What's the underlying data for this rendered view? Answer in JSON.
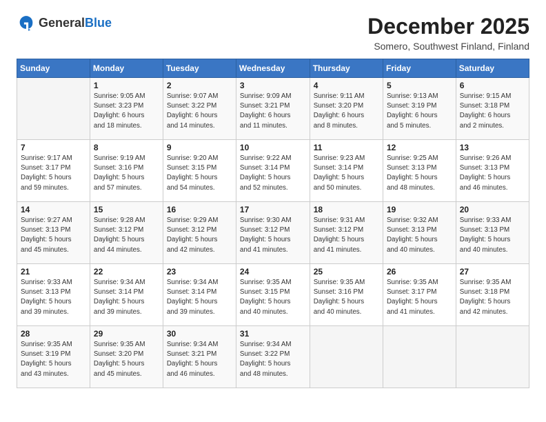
{
  "header": {
    "logo_general": "General",
    "logo_blue": "Blue",
    "month": "December 2025",
    "location": "Somero, Southwest Finland, Finland"
  },
  "weekdays": [
    "Sunday",
    "Monday",
    "Tuesday",
    "Wednesday",
    "Thursday",
    "Friday",
    "Saturday"
  ],
  "weeks": [
    [
      {
        "day": "",
        "info": ""
      },
      {
        "day": "1",
        "info": "Sunrise: 9:05 AM\nSunset: 3:23 PM\nDaylight: 6 hours\nand 18 minutes."
      },
      {
        "day": "2",
        "info": "Sunrise: 9:07 AM\nSunset: 3:22 PM\nDaylight: 6 hours\nand 14 minutes."
      },
      {
        "day": "3",
        "info": "Sunrise: 9:09 AM\nSunset: 3:21 PM\nDaylight: 6 hours\nand 11 minutes."
      },
      {
        "day": "4",
        "info": "Sunrise: 9:11 AM\nSunset: 3:20 PM\nDaylight: 6 hours\nand 8 minutes."
      },
      {
        "day": "5",
        "info": "Sunrise: 9:13 AM\nSunset: 3:19 PM\nDaylight: 6 hours\nand 5 minutes."
      },
      {
        "day": "6",
        "info": "Sunrise: 9:15 AM\nSunset: 3:18 PM\nDaylight: 6 hours\nand 2 minutes."
      }
    ],
    [
      {
        "day": "7",
        "info": "Sunrise: 9:17 AM\nSunset: 3:17 PM\nDaylight: 5 hours\nand 59 minutes."
      },
      {
        "day": "8",
        "info": "Sunrise: 9:19 AM\nSunset: 3:16 PM\nDaylight: 5 hours\nand 57 minutes."
      },
      {
        "day": "9",
        "info": "Sunrise: 9:20 AM\nSunset: 3:15 PM\nDaylight: 5 hours\nand 54 minutes."
      },
      {
        "day": "10",
        "info": "Sunrise: 9:22 AM\nSunset: 3:14 PM\nDaylight: 5 hours\nand 52 minutes."
      },
      {
        "day": "11",
        "info": "Sunrise: 9:23 AM\nSunset: 3:14 PM\nDaylight: 5 hours\nand 50 minutes."
      },
      {
        "day": "12",
        "info": "Sunrise: 9:25 AM\nSunset: 3:13 PM\nDaylight: 5 hours\nand 48 minutes."
      },
      {
        "day": "13",
        "info": "Sunrise: 9:26 AM\nSunset: 3:13 PM\nDaylight: 5 hours\nand 46 minutes."
      }
    ],
    [
      {
        "day": "14",
        "info": "Sunrise: 9:27 AM\nSunset: 3:13 PM\nDaylight: 5 hours\nand 45 minutes."
      },
      {
        "day": "15",
        "info": "Sunrise: 9:28 AM\nSunset: 3:12 PM\nDaylight: 5 hours\nand 44 minutes."
      },
      {
        "day": "16",
        "info": "Sunrise: 9:29 AM\nSunset: 3:12 PM\nDaylight: 5 hours\nand 42 minutes."
      },
      {
        "day": "17",
        "info": "Sunrise: 9:30 AM\nSunset: 3:12 PM\nDaylight: 5 hours\nand 41 minutes."
      },
      {
        "day": "18",
        "info": "Sunrise: 9:31 AM\nSunset: 3:12 PM\nDaylight: 5 hours\nand 41 minutes."
      },
      {
        "day": "19",
        "info": "Sunrise: 9:32 AM\nSunset: 3:13 PM\nDaylight: 5 hours\nand 40 minutes."
      },
      {
        "day": "20",
        "info": "Sunrise: 9:33 AM\nSunset: 3:13 PM\nDaylight: 5 hours\nand 40 minutes."
      }
    ],
    [
      {
        "day": "21",
        "info": "Sunrise: 9:33 AM\nSunset: 3:13 PM\nDaylight: 5 hours\nand 39 minutes."
      },
      {
        "day": "22",
        "info": "Sunrise: 9:34 AM\nSunset: 3:14 PM\nDaylight: 5 hours\nand 39 minutes."
      },
      {
        "day": "23",
        "info": "Sunrise: 9:34 AM\nSunset: 3:14 PM\nDaylight: 5 hours\nand 39 minutes."
      },
      {
        "day": "24",
        "info": "Sunrise: 9:35 AM\nSunset: 3:15 PM\nDaylight: 5 hours\nand 40 minutes."
      },
      {
        "day": "25",
        "info": "Sunrise: 9:35 AM\nSunset: 3:16 PM\nDaylight: 5 hours\nand 40 minutes."
      },
      {
        "day": "26",
        "info": "Sunrise: 9:35 AM\nSunset: 3:17 PM\nDaylight: 5 hours\nand 41 minutes."
      },
      {
        "day": "27",
        "info": "Sunrise: 9:35 AM\nSunset: 3:18 PM\nDaylight: 5 hours\nand 42 minutes."
      }
    ],
    [
      {
        "day": "28",
        "info": "Sunrise: 9:35 AM\nSunset: 3:19 PM\nDaylight: 5 hours\nand 43 minutes."
      },
      {
        "day": "29",
        "info": "Sunrise: 9:35 AM\nSunset: 3:20 PM\nDaylight: 5 hours\nand 45 minutes."
      },
      {
        "day": "30",
        "info": "Sunrise: 9:34 AM\nSunset: 3:21 PM\nDaylight: 5 hours\nand 46 minutes."
      },
      {
        "day": "31",
        "info": "Sunrise: 9:34 AM\nSunset: 3:22 PM\nDaylight: 5 hours\nand 48 minutes."
      },
      {
        "day": "",
        "info": ""
      },
      {
        "day": "",
        "info": ""
      },
      {
        "day": "",
        "info": ""
      }
    ]
  ]
}
